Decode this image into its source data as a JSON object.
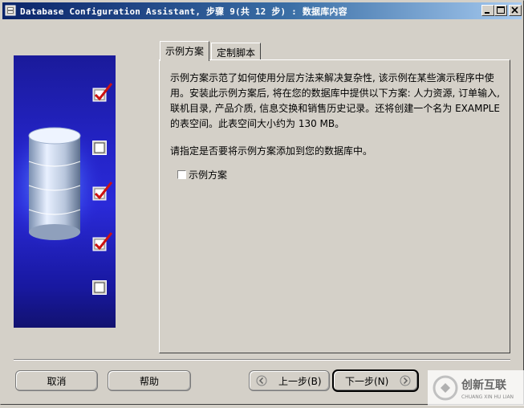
{
  "window": {
    "title": "Database Configuration Assistant, 步骤 9(共 12 步) : 数据库内容",
    "controls": [
      "minimize-icon",
      "maximize-icon",
      "close-icon"
    ]
  },
  "steps": [
    {
      "checked": true
    },
    {
      "checked": false
    },
    {
      "checked": true
    },
    {
      "checked": true
    },
    {
      "checked": false
    }
  ],
  "tabs": [
    {
      "label": "示例方案",
      "active": true
    },
    {
      "label": "定制脚本",
      "active": false
    }
  ],
  "content": {
    "description": "示例方案示范了如何使用分层方法来解决复杂性, 该示例在某些演示程序中使用。安装此示例方案后, 将在您的数据库中提供以下方案: 人力资源, 订单输入, 联机目录, 产品介质, 信息交换和销售历史记录。还将创建一个名为 EXAMPLE 的表空间。此表空间大小约为 130 MB。",
    "prompt": "请指定是否要将示例方案添加到您的数据库中。",
    "checkbox_label": "示例方案",
    "checkbox_checked": false
  },
  "buttons": {
    "cancel": "取消",
    "help": "帮助",
    "back": "上一步(B)",
    "next": "下一步(N)"
  },
  "watermark": {
    "cn": "创新互联",
    "en": "CHUANG XIN HU LIAN"
  },
  "colors": {
    "titlebar_start": "#0a246a",
    "titlebar_end": "#a6caf0",
    "panel_blue": "#2424c8",
    "check_red": "#cc1111",
    "dialog_bg": "#d4d0c8"
  }
}
